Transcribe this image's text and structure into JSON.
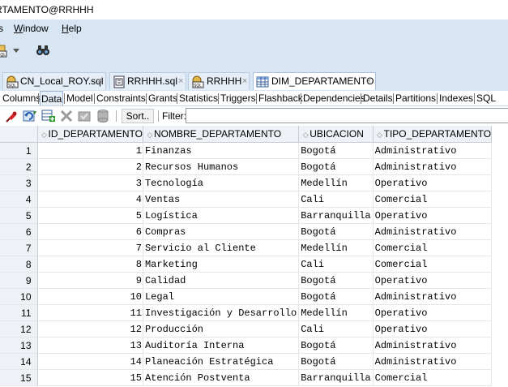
{
  "window": {
    "title": "RTAMENTO@RRHHH"
  },
  "menu": [
    {
      "label": "s"
    },
    {
      "label": "Window",
      "underline": "W",
      "rest": "indow"
    },
    {
      "label": "Help",
      "underline": "H",
      "rest": "elp"
    }
  ],
  "toolbar": {
    "icons": [
      "sql-worksheet-icon",
      "dropdown-arrow-icon",
      "binoculars-icon"
    ]
  },
  "editor_tabs": [
    {
      "label": "CN_Local_ROY.sql",
      "icon": "sql-worksheet-icon",
      "active": false
    },
    {
      "label": "RRHHH.sql",
      "icon": "sql-file-icon",
      "active": false
    },
    {
      "label": "RRHHH",
      "icon": "sql-worksheet-icon",
      "active": false
    },
    {
      "label": "DIM_DEPARTAMENTO",
      "icon": "table-icon",
      "active": true
    }
  ],
  "close_glyph": "×",
  "subtabs": [
    "Columns",
    "Data",
    "Model",
    "Constraints",
    "Grants",
    "Statistics",
    "Triggers",
    "Flashback",
    "Dependencies",
    "Details",
    "Partitions",
    "Indexes",
    "SQL"
  ],
  "active_subtab": "Data",
  "grid_toolbar": {
    "icons": [
      "freeze-pin-icon",
      "refresh-icon",
      "insert-row-icon",
      "delete-row-icon",
      "commit-icon",
      "rollback-icon"
    ],
    "sort_label": "Sort..",
    "filter_label": "Filter:",
    "filter_value": ""
  },
  "table": {
    "columns": [
      "ID_DEPARTAMENTO",
      "NOMBRE_DEPARTAMENTO",
      "UBICACION",
      "TIPO_DEPARTAMENTO"
    ],
    "rows": [
      [
        "1",
        "1",
        "Finanzas",
        "Bogotá",
        "Administrativo"
      ],
      [
        "2",
        "2",
        "Recursos Humanos",
        "Bogotá",
        "Administrativo"
      ],
      [
        "3",
        "3",
        "Tecnología",
        "Medellín",
        "Operativo"
      ],
      [
        "4",
        "4",
        "Ventas",
        "Cali",
        "Comercial"
      ],
      [
        "5",
        "5",
        "Logística",
        "Barranquilla",
        "Operativo"
      ],
      [
        "6",
        "6",
        "Compras",
        "Bogotá",
        "Administrativo"
      ],
      [
        "7",
        "7",
        "Servicio al Cliente",
        "Medellín",
        "Comercial"
      ],
      [
        "8",
        "8",
        "Marketing",
        "Cali",
        "Comercial"
      ],
      [
        "9",
        "9",
        "Calidad",
        "Bogotá",
        "Operativo"
      ],
      [
        "10",
        "10",
        "Legal",
        "Bogotá",
        "Administrativo"
      ],
      [
        "11",
        "11",
        "Investigación y Desarrollo",
        "Medellín",
        "Operativo"
      ],
      [
        "12",
        "12",
        "Producción",
        "Cali",
        "Operativo"
      ],
      [
        "13",
        "13",
        "Auditoría Interna",
        "Bogotá",
        "Administrativo"
      ],
      [
        "14",
        "14",
        "Planeación Estratégica",
        "Bogotá",
        "Administrativo"
      ],
      [
        "15",
        "15",
        "Atención Postventa",
        "Barranquilla",
        "Comercial"
      ]
    ]
  },
  "colors": {
    "chrome": "#d8e5f3",
    "accent": "#2a6ab7"
  }
}
